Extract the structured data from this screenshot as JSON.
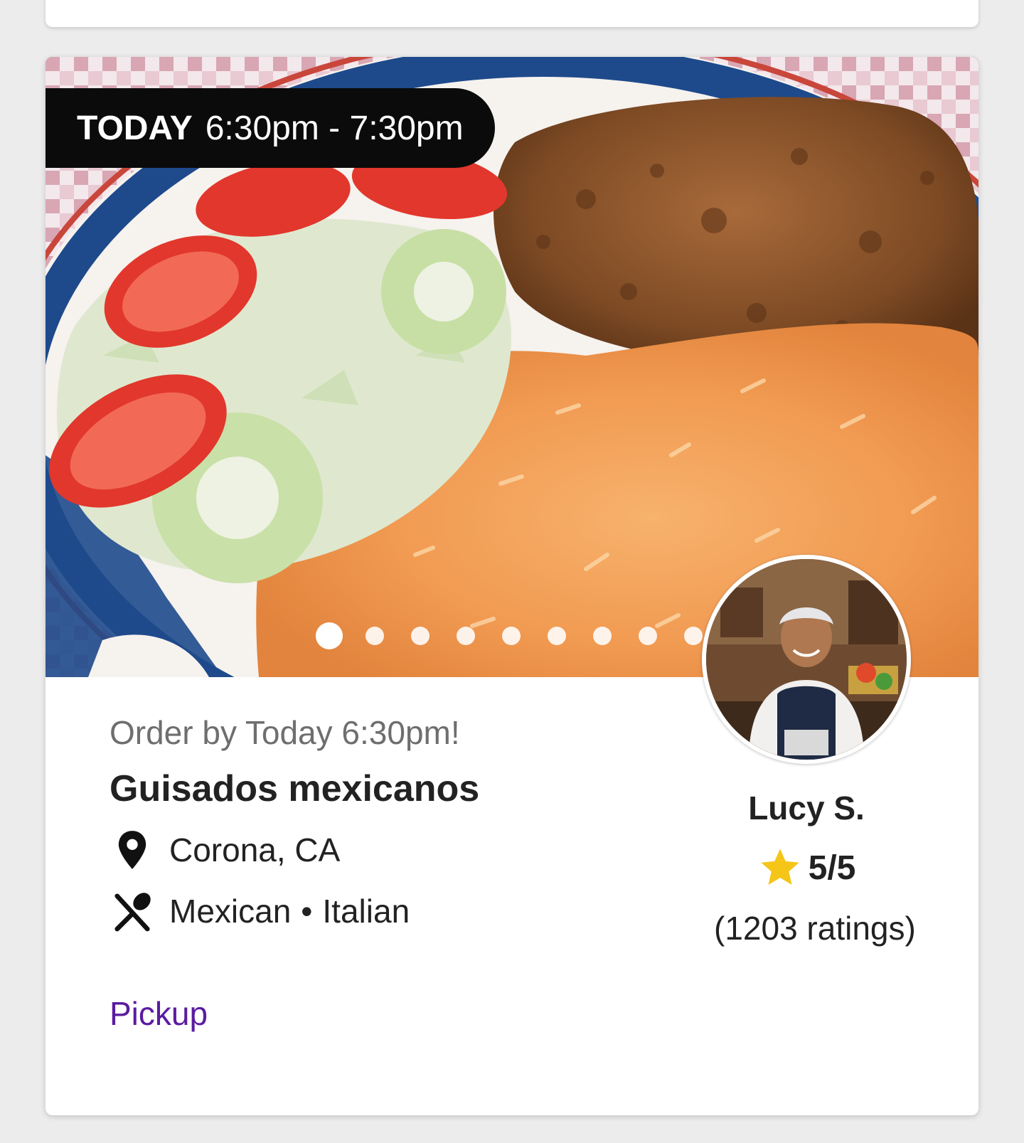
{
  "listing": {
    "time_badge": {
      "day_label": "TODAY",
      "time_range": "6:30pm - 7:30pm"
    },
    "photo": {
      "description_icon": "food-photo",
      "carousel": {
        "total": 9,
        "active_index": 0
      }
    },
    "order_by": "Order by Today 6:30pm!",
    "title": "Guisados mexicanos",
    "location": "Corona, CA",
    "location_icon": "map-pin-icon",
    "cuisines": {
      "first": "Mexican",
      "separator": "•",
      "second": "Italian"
    },
    "cuisine_icon": "utensils-icon",
    "fulfillment": "Pickup",
    "cook": {
      "name": "Lucy S.",
      "rating": "5/5",
      "ratings_count": "(1203 ratings)",
      "star_color": "#f5c518"
    }
  },
  "colors": {
    "accent": "#5b1ba0",
    "badge_bg": "#0b0b0b",
    "card_bg": "#ffffff",
    "page_bg": "#ececec"
  }
}
